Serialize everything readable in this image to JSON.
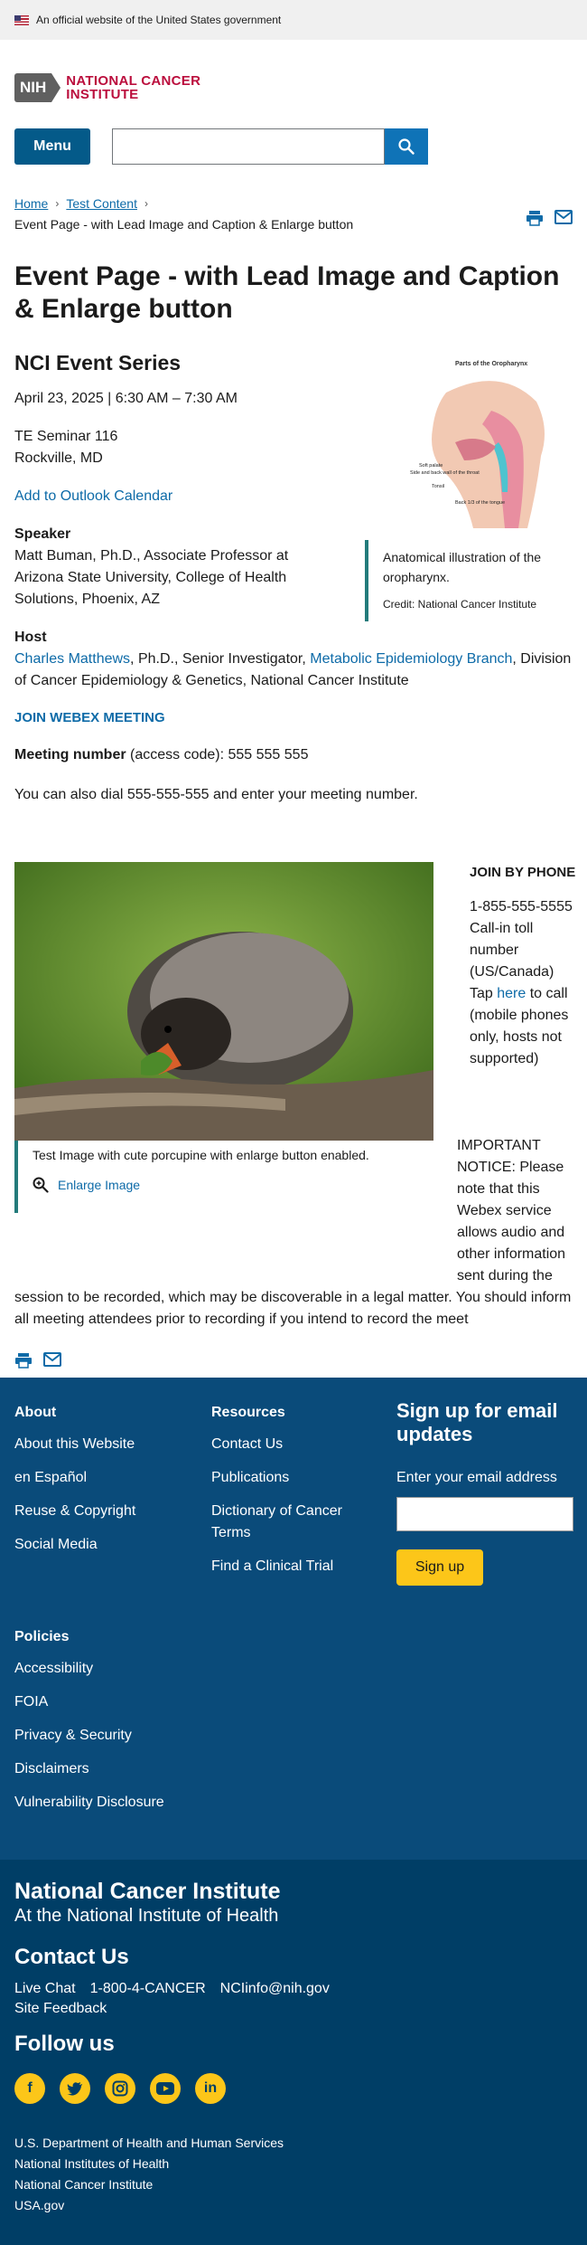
{
  "banner": {
    "text": "An official website of the United States government"
  },
  "logo": {
    "nih": "NIH",
    "line1": "NATIONAL CANCER",
    "line2": "INSTITUTE"
  },
  "nav": {
    "menu_label": "Menu",
    "search_placeholder": ""
  },
  "breadcrumb": {
    "home": "Home",
    "test_content": "Test Content",
    "current": "Event Page - with Lead Image and Caption & Enlarge button"
  },
  "page": {
    "title": "Event Page - with Lead Image and Caption & Enlarge button",
    "series": "NCI Event Series",
    "datetime": "April 23, 2025 | 6:30 AM – 7:30 AM",
    "location_line1": "TE Seminar 116",
    "location_line2": "Rockville, MD",
    "calendar_link": "Add to Outlook Calendar",
    "speaker_heading": "Speaker",
    "speaker_text": "Matt Buman, Ph.D., Associate Professor at Arizona State University, College of Health Solutions, Phoenix, AZ",
    "host_heading": "Host",
    "host_link1": "Charles Matthews",
    "host_text1": ", Ph.D., Senior Investigator,  ",
    "host_link2": "Metabolic Epidemiology Branch",
    "host_text2": ", Division of Cancer Epidemiology & Genetics, National Cancer Institute",
    "join_link": "JOIN WEBEX MEETING",
    "meeting_label": "Meeting number",
    "meeting_text": " (access code): 555 555 555",
    "dial_text": "You can also dial 555-555-555 and enter your meeting number."
  },
  "figure_right": {
    "image_title": "Parts of the Oropharynx",
    "label_soft_palate": "Soft palate",
    "label_side_back": "Side and back wall of the throat",
    "label_tonsil": "Tonsil",
    "label_back_tongue": "Back 1/3 of the tongue",
    "caption": "Anatomical illustration of the oropharynx.",
    "credit": "Credit: National Cancer Institute"
  },
  "porcupine": {
    "caption": "Test Image with cute porcupine with enlarge button enabled.",
    "enlarge": "Enlarge Image"
  },
  "phone": {
    "heading": "JOIN BY PHONE",
    "number": "1-855-555-5555 Call-in toll number (US/Canada)",
    "tap_prefix": "Tap ",
    "tap_link": "here",
    "tap_suffix": " to call (mobile phones only, hosts not supported)"
  },
  "notice": "IMPORTANT NOTICE: Please note that this Webex service allows audio and other information sent during the session to be recorded, which may be discoverable in a legal matter. You should inform all meeting attendees prior to recording if you intend to record the meet",
  "footer": {
    "about_heading": "About",
    "about_links": [
      "About this Website",
      "en Español",
      "Reuse & Copyright",
      "Social Media"
    ],
    "resources_heading": "Resources",
    "resources_links": [
      "Contact Us",
      "Publications",
      "Dictionary of Cancer Terms",
      "Find a Clinical Trial"
    ],
    "signup_heading": "Sign up for email updates",
    "email_label": "Enter your email address",
    "signup_button": "Sign up",
    "policies_heading": "Policies",
    "policies_links": [
      "Accessibility",
      "FOIA",
      "Privacy & Security",
      "Disclaimers",
      "Vulnerability Disclosure"
    ]
  },
  "footer2": {
    "org_name": "National Cancer Institute",
    "org_sub": "At the National Institute of Health",
    "contact_heading": "Contact Us",
    "live_chat": "Live Chat",
    "phone": "1-800-4-CANCER",
    "email": "NCIinfo@nih.gov",
    "feedback": "Site Feedback",
    "follow_heading": "Follow us",
    "social_icons": [
      "facebook-icon",
      "twitter-icon",
      "instagram-icon",
      "youtube-icon",
      "linkedin-icon"
    ],
    "links": [
      "U.S. Department of Health and Human Services",
      "National Institutes of Health",
      "National Cancer Institute",
      "USA.gov"
    ]
  },
  "colors": {
    "primary_blue": "#0e6ba8",
    "nav_blue": "#045a89",
    "footer_blue": "#0a4b7a",
    "footer_dark": "#003e66",
    "accent_yellow": "#fcc619",
    "nci_red": "#bb0e3d",
    "caption_border": "#237b7b"
  }
}
